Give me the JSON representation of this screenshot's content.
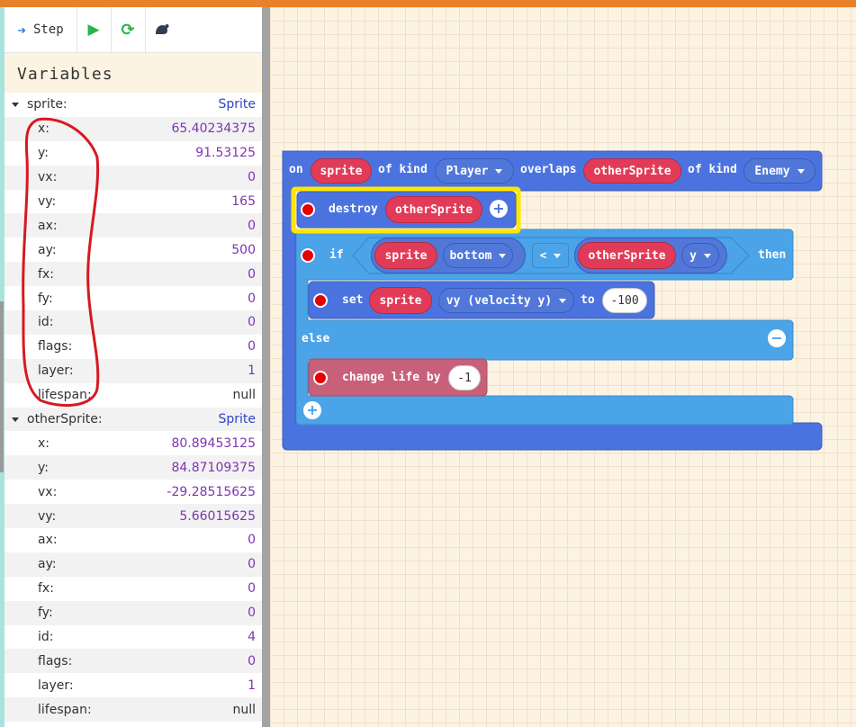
{
  "toolbar": {
    "step_label": "Step",
    "step_icon": "arrow-right-icon",
    "play_icon": "play-icon",
    "restart_icon": "restart-icon",
    "slow_icon": "snail-icon"
  },
  "variables": {
    "title": "Variables",
    "groups": [
      {
        "name": "sprite:",
        "type": "Sprite",
        "fields": [
          {
            "name": "x:",
            "value": "65.40234375"
          },
          {
            "name": "y:",
            "value": "91.53125"
          },
          {
            "name": "vx:",
            "value": "0"
          },
          {
            "name": "vy:",
            "value": "165"
          },
          {
            "name": "ax:",
            "value": "0"
          },
          {
            "name": "ay:",
            "value": "500"
          },
          {
            "name": "fx:",
            "value": "0"
          },
          {
            "name": "fy:",
            "value": "0"
          },
          {
            "name": "id:",
            "value": "0"
          },
          {
            "name": "flags:",
            "value": "0"
          },
          {
            "name": "layer:",
            "value": "1"
          },
          {
            "name": "lifespan:",
            "value": "null"
          }
        ]
      },
      {
        "name": "otherSprite:",
        "type": "Sprite",
        "fields": [
          {
            "name": "x:",
            "value": "80.89453125"
          },
          {
            "name": "y:",
            "value": "84.87109375"
          },
          {
            "name": "vx:",
            "value": "-29.28515625"
          },
          {
            "name": "vy:",
            "value": "5.66015625"
          },
          {
            "name": "ax:",
            "value": "0"
          },
          {
            "name": "ay:",
            "value": "0"
          },
          {
            "name": "fx:",
            "value": "0"
          },
          {
            "name": "fy:",
            "value": "0"
          },
          {
            "name": "id:",
            "value": "4"
          },
          {
            "name": "flags:",
            "value": "0"
          },
          {
            "name": "layer:",
            "value": "1"
          },
          {
            "name": "lifespan:",
            "value": "null"
          }
        ]
      }
    ]
  },
  "blocks": {
    "event": {
      "on": "on",
      "sprite_var": "sprite",
      "of_kind_1": "of kind",
      "kind_1": "Player",
      "overlaps": "overlaps",
      "other_var": "otherSprite",
      "of_kind_2": "of kind",
      "kind_2": "Enemy"
    },
    "destroy": {
      "label": "destroy",
      "arg": "otherSprite"
    },
    "if": {
      "if_label": "if",
      "left_var": "sprite",
      "left_prop": "bottom",
      "op": "<",
      "right_var": "otherSprite",
      "right_prop": "y",
      "then_label": "then"
    },
    "set": {
      "label": "set",
      "var": "sprite",
      "prop": "vy (velocity y)",
      "to": "to",
      "value": "-100"
    },
    "else_label": "else",
    "change": {
      "label": "change life by",
      "value": "-1"
    }
  },
  "colors": {
    "accent_bar": "#e8822a",
    "event_block": "#4b73e0",
    "logic_block": "#4ba3e8",
    "variable_pill": "#e23b57",
    "info_block": "#c9607a",
    "highlight_box": "#ffe600",
    "annotation_ink": "#d71920",
    "breakpoint": "#e60000"
  }
}
